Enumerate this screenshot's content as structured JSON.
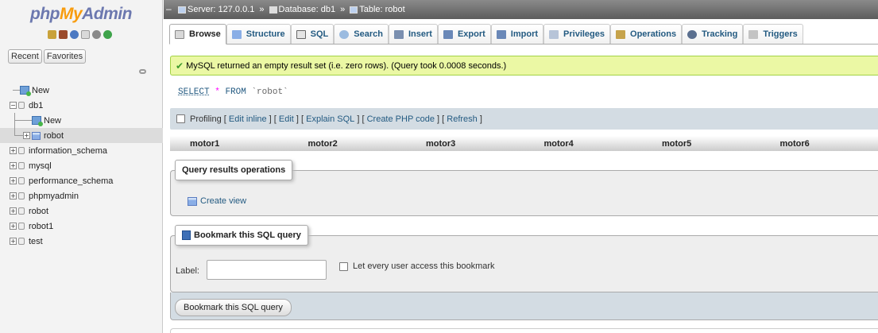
{
  "nav": {
    "logo": {
      "php": "php",
      "my": "My",
      "admin": "Admin"
    },
    "tabs": [
      "Recent",
      "Favorites"
    ],
    "tree": [
      {
        "label": "New",
        "level": 0,
        "icon": "new"
      },
      {
        "label": "db1",
        "level": 0,
        "icon": "db",
        "expanded": true
      },
      {
        "label": "New",
        "level": 1,
        "icon": "new"
      },
      {
        "label": "robot",
        "level": 1,
        "icon": "table",
        "selected": true
      },
      {
        "label": "information_schema",
        "level": 0,
        "icon": "db"
      },
      {
        "label": "mysql",
        "level": 0,
        "icon": "db"
      },
      {
        "label": "performance_schema",
        "level": 0,
        "icon": "db"
      },
      {
        "label": "phpmyadmin",
        "level": 0,
        "icon": "db"
      },
      {
        "label": "robot",
        "level": 0,
        "icon": "db"
      },
      {
        "label": "robot1",
        "level": 0,
        "icon": "db"
      },
      {
        "label": "test",
        "level": 0,
        "icon": "db"
      }
    ]
  },
  "topbar": {
    "server": "Server: 127.0.0.1",
    "database": "Database: db1",
    "table": "Table: robot",
    "separator": "»"
  },
  "tabs": [
    {
      "label": "Browse",
      "icon": "browse-icon",
      "active": true
    },
    {
      "label": "Structure",
      "icon": "structure-icon"
    },
    {
      "label": "SQL",
      "icon": "sql-icon"
    },
    {
      "label": "Search",
      "icon": "search-icon"
    },
    {
      "label": "Insert",
      "icon": "insert-icon"
    },
    {
      "label": "Export",
      "icon": "export-icon"
    },
    {
      "label": "Import",
      "icon": "import-icon"
    },
    {
      "label": "Privileges",
      "icon": "privileges-icon"
    },
    {
      "label": "Operations",
      "icon": "operations-icon"
    },
    {
      "label": "Tracking",
      "icon": "tracking-icon"
    },
    {
      "label": "Triggers",
      "icon": "triggers-icon"
    }
  ],
  "message": {
    "text": "MySQL returned an empty result set (i.e. zero rows). (Query took 0.0008 seconds.)"
  },
  "query": {
    "select": "SELECT",
    "star": "*",
    "from": "FROM",
    "table": "`robot`"
  },
  "profiling": {
    "label": "Profiling",
    "links": [
      "Edit inline",
      "Edit",
      "Explain SQL",
      "Create PHP code",
      "Refresh"
    ]
  },
  "columns": [
    "motor1",
    "motor2",
    "motor3",
    "motor4",
    "motor5",
    "motor6"
  ],
  "query_results": {
    "legend": "Query results operations",
    "create_view": "Create view"
  },
  "bookmark": {
    "legend": "Bookmark this SQL query",
    "label": "Label:",
    "label_value": "",
    "share": "Let every user access this bookmark",
    "button": "Bookmark this SQL query"
  },
  "colors": {
    "link": "#235a81",
    "success_bg": "#ebf8a4",
    "panel_bg": "#d3dce3"
  }
}
